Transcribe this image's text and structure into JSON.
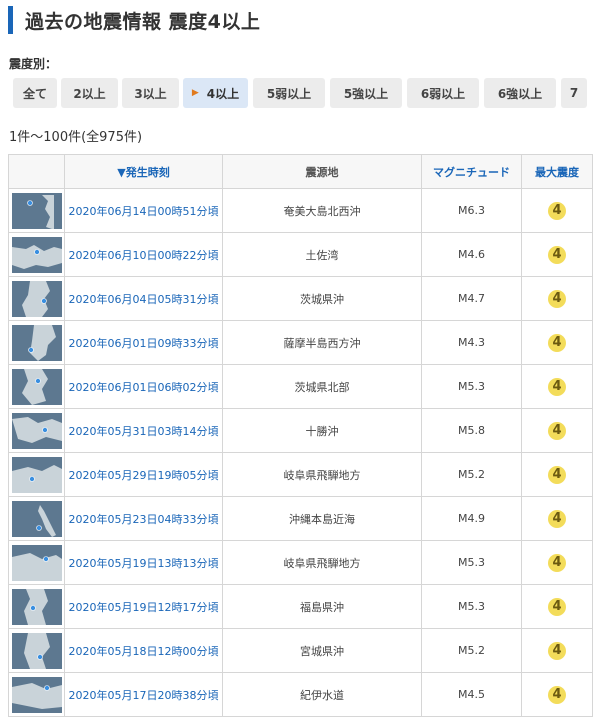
{
  "page": {
    "title": "過去の地震情報 震度4以上"
  },
  "filter": {
    "label": "震度別：",
    "options": [
      "全て",
      "2以上",
      "3以上",
      "4以上",
      "5弱以上",
      "5強以上",
      "6弱以上",
      "6強以上",
      "7"
    ],
    "selected": "4以上"
  },
  "results": {
    "count_text": "1件〜100件(全975件)"
  },
  "table": {
    "headers": {
      "date": "▼発生時刻",
      "region": "震源地",
      "magnitude": "マグニチュード",
      "intensity": "最大震度"
    },
    "rows": [
      {
        "date": "2020年06月14日00時51分頃",
        "region": "奄美大島北西沖",
        "magnitude": "M6.3",
        "intensity": "4"
      },
      {
        "date": "2020年06月10日00時22分頃",
        "region": "土佐湾",
        "magnitude": "M4.6",
        "intensity": "4"
      },
      {
        "date": "2020年06月04日05時31分頃",
        "region": "茨城県沖",
        "magnitude": "M4.7",
        "intensity": "4"
      },
      {
        "date": "2020年06月01日09時33分頃",
        "region": "薩摩半島西方沖",
        "magnitude": "M4.3",
        "intensity": "4"
      },
      {
        "date": "2020年06月01日06時02分頃",
        "region": "茨城県北部",
        "magnitude": "M5.3",
        "intensity": "4"
      },
      {
        "date": "2020年05月31日03時14分頃",
        "region": "十勝沖",
        "magnitude": "M5.8",
        "intensity": "4"
      },
      {
        "date": "2020年05月29日19時05分頃",
        "region": "岐阜県飛騨地方",
        "magnitude": "M5.2",
        "intensity": "4"
      },
      {
        "date": "2020年05月23日04時33分頃",
        "region": "沖縄本島近海",
        "magnitude": "M4.9",
        "intensity": "4"
      },
      {
        "date": "2020年05月19日13時13分頃",
        "region": "岐阜県飛騨地方",
        "magnitude": "M5.3",
        "intensity": "4"
      },
      {
        "date": "2020年05月19日12時17分頃",
        "region": "福島県沖",
        "magnitude": "M5.3",
        "intensity": "4"
      },
      {
        "date": "2020年05月18日12時00分頃",
        "region": "宮城県沖",
        "magnitude": "M5.2",
        "intensity": "4"
      },
      {
        "date": "2020年05月17日20時38分頃",
        "region": "紀伊水道",
        "magnitude": "M4.5",
        "intensity": "4"
      }
    ]
  },
  "colors": {
    "accent": "#1a66b8",
    "badge": "#f3dc5a",
    "map_sea": "#5d7890",
    "map_land": "#c9d3d9"
  }
}
